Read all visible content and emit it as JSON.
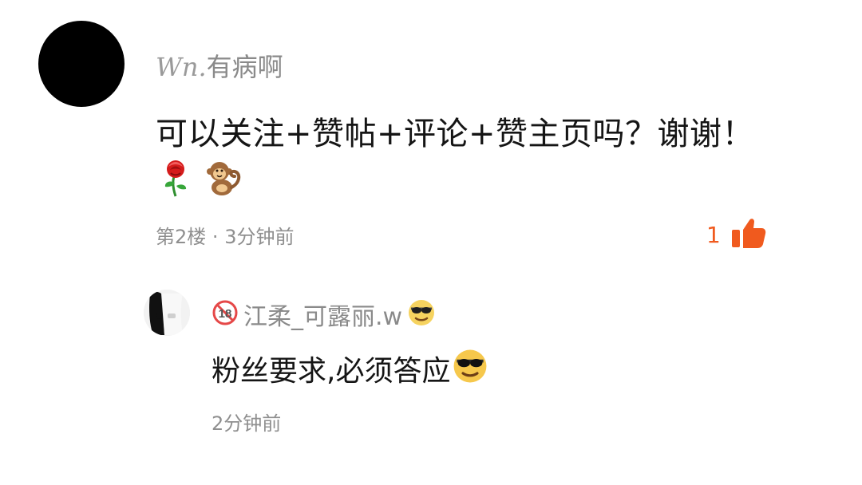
{
  "comment": {
    "username_script": "Wn.",
    "username_suffix": "有病啊",
    "text": "可以关注+赞帖+评论+赞主页吗？谢谢！",
    "emojis": [
      "rose-emoji",
      "monkey-emoji"
    ],
    "floor": "第2楼",
    "separator": "·",
    "time": "3分钟前",
    "like_count": "1",
    "colors": {
      "like": "#f05a1e",
      "meta": "#8f8f8f",
      "username": "#8a8a8a"
    },
    "icons": {
      "avatar": "black-avatar",
      "like": "thumbs-up-icon"
    }
  },
  "reply": {
    "badge": "18",
    "username": "江柔_可露丽.w",
    "name_emoji": "sunglasses-emoji",
    "text": "粉丝要求,必须答应",
    "text_emoji": "sunglasses-emoji",
    "time": "2分钟前",
    "icons": {
      "avatar": "reply-avatar",
      "badge": "18-badge-icon"
    }
  }
}
